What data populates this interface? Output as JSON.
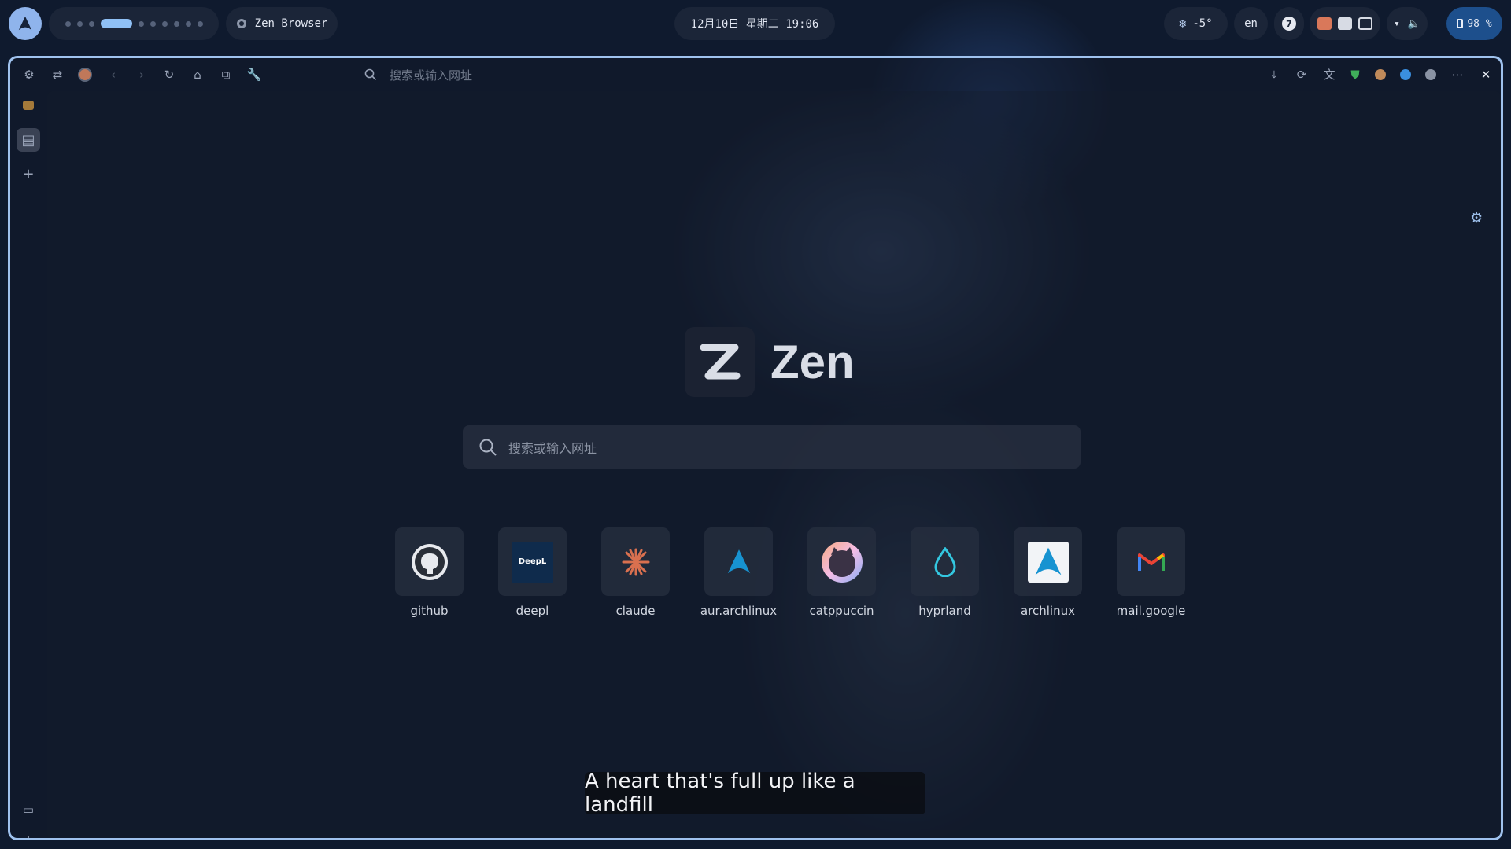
{
  "topbar": {
    "app_name": "Zen Browser",
    "clock": "12月10日  星期二  19:06",
    "weather": "-5°",
    "language": "en",
    "notifications": "7",
    "battery": "98 %"
  },
  "browser": {
    "urlbar_placeholder": "搜索或输入网址",
    "brand": "Zen",
    "search_placeholder": "搜索或输入网址",
    "shortcuts": [
      {
        "label": "github"
      },
      {
        "label": "deepl"
      },
      {
        "label": "claude"
      },
      {
        "label": "aur.archlinux"
      },
      {
        "label": "catppuccin"
      },
      {
        "label": "hyprland"
      },
      {
        "label": "archlinux"
      },
      {
        "label": "mail.google"
      }
    ],
    "deepl_logo_text": "DeepL"
  },
  "overlay": {
    "lyric": "A heart that's full up like a landfill"
  },
  "colors": {
    "accent": "#9fc2ee",
    "workspace_active": "#8fc0f5",
    "battery_bg": "#1d4f8c"
  }
}
